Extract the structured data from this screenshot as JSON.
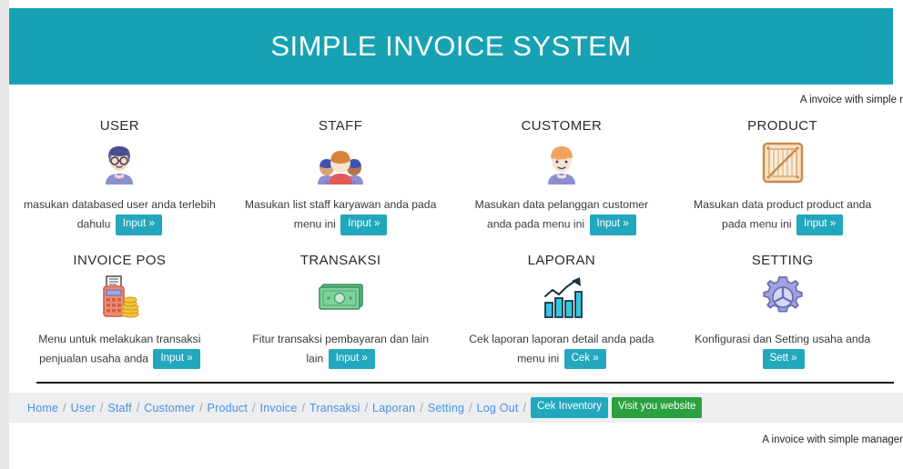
{
  "header": {
    "title": "SIMPLE INVOICE SYSTEM",
    "background_color": "#17a2b4"
  },
  "tagline_top": "A invoice with simple r",
  "tagline_bottom": "A invoice with simple manager",
  "cards": [
    {
      "title": "USER",
      "icon": "user-avatar-icon",
      "text": "masukan databased user anda terlebih dahulu",
      "button_label": "Input »"
    },
    {
      "title": "STAFF",
      "icon": "three-people-icon",
      "text": "Masukan list staff karyawan anda pada menu ini",
      "button_label": "Input »"
    },
    {
      "title": "CUSTOMER",
      "icon": "customer-avatar-icon",
      "text": "Masukan data pelanggan customer anda pada menu ini",
      "button_label": "Input »"
    },
    {
      "title": "PRODUCT",
      "icon": "wooden-crate-icon",
      "text": "Masukan data product product anda pada menu ini",
      "button_label": "Input »"
    },
    {
      "title": "INVOICE POS",
      "icon": "cash-register-icon",
      "text": "Menu untuk melakukan transaksi penjualan usaha anda",
      "button_label": "Input »"
    },
    {
      "title": "TRANSAKSI",
      "icon": "banknotes-icon",
      "text": "Fitur transaksi pembayaran dan lain lain",
      "button_label": "Input »"
    },
    {
      "title": "LAPORAN",
      "icon": "bar-chart-growth-icon",
      "text": "Cek laporan laporan detail anda pada menu ini",
      "button_label": "Cek »"
    },
    {
      "title": "SETTING",
      "icon": "gear-icon",
      "text": "Konfigurasi dan Setting usaha anda",
      "button_label": "Sett »"
    }
  ],
  "footer_nav": {
    "links": [
      "Home",
      "User",
      "Staff",
      "Customer",
      "Product",
      "Invoice",
      "Transaksi",
      "Laporan",
      "Setting",
      "Log Out"
    ],
    "separator": "/",
    "buttons": [
      {
        "label": "Cek Inventory",
        "color": "#22a7bd"
      },
      {
        "label": "Visit you website",
        "color": "#2aa03f"
      }
    ]
  },
  "colors": {
    "accent_teal": "#17a2b4",
    "button_teal": "#22a7bd",
    "button_green": "#2aa03f",
    "link_blue": "#4a90e2",
    "nav_background": "#eceef0"
  }
}
